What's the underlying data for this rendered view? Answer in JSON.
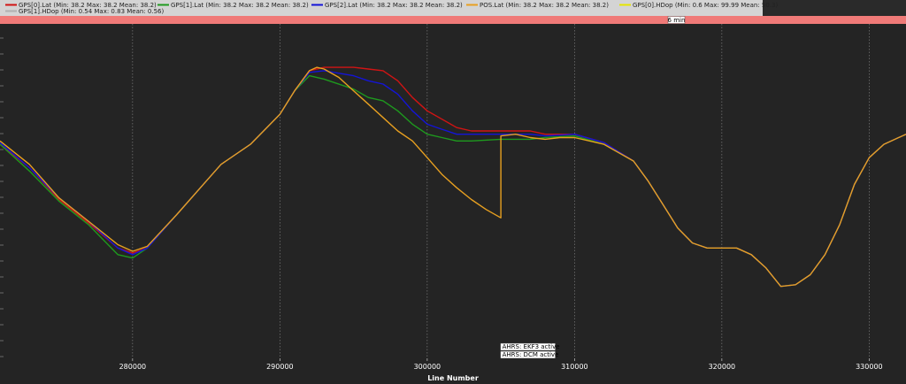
{
  "chart_data": {
    "type": "line",
    "xlabel": "Line Number",
    "ylabel": "",
    "xlim": [
      271000,
      332500
    ],
    "ylim": [
      0,
      1
    ],
    "x_ticks": [
      "280000",
      "290000",
      "300000",
      "310000",
      "320000",
      "330000"
    ],
    "x_tick_values": [
      280000,
      290000,
      300000,
      310000,
      320000,
      330000
    ],
    "grid": true,
    "legend_position": "top",
    "colors": {
      "background": "#242424",
      "grid": "#8a8a8a",
      "axis_band": "#d6d6d6",
      "legend_bg": "#d4d4d4",
      "time_band": "#f07a78"
    },
    "legend": [
      {
        "label": "GPS[0].Lat  (Min: 38.2 Max: 38.2 Mean: 38.2)",
        "color": "#d11414"
      },
      {
        "label": "GPS[1].Lat  (Min: 38.2 Max: 38.2 Mean: 38.2)",
        "color": "#1e9a1e"
      },
      {
        "label": "GPS[2].Lat  (Min: 38.2 Max: 38.2 Mean: 38.2)",
        "color": "#1414d8"
      },
      {
        "label": "POS.Lat  (Min: 38.2 Max: 38.2 Mean: 38.2)",
        "color": "#e8a020"
      },
      {
        "label": "GPS[0].HDop  (Min: 0.6 Max: 99.99 Mean: 50.3)",
        "color": "#e6e600"
      },
      {
        "label": "GPS[1].HDop  (Min: 0.54 Max: 0.83 Mean: 0.56)",
        "color": "#b0b0b0"
      }
    ],
    "time_marker": "6 min",
    "annotations": [
      "AHRS: EKF3 active",
      "AHRS: DCM active"
    ],
    "annotation_x": 305000,
    "series": [
      {
        "name": "GPS[0].Lat",
        "color": "#d11414",
        "x": [
          271000,
          273000,
          275000,
          277000,
          279000,
          280000,
          281000,
          283000,
          285000,
          286000,
          288000,
          290000,
          291000,
          292000,
          293000,
          295000,
          296000,
          297000,
          298000,
          299000,
          300000,
          301000,
          302000,
          303000,
          305000,
          307000,
          308000,
          310000,
          312000,
          314000,
          315000,
          316000,
          317000,
          318000,
          319000,
          320000,
          321000,
          322000,
          323000,
          324000,
          325000,
          326000,
          327000,
          328000,
          329000,
          330000,
          331000,
          332500
        ],
        "y": [
          0.64,
          0.57,
          0.475,
          0.405,
          0.33,
          0.315,
          0.33,
          0.43,
          0.53,
          0.58,
          0.64,
          0.73,
          0.8,
          0.86,
          0.87,
          0.87,
          0.865,
          0.86,
          0.83,
          0.78,
          0.74,
          0.715,
          0.69,
          0.68,
          0.68,
          0.68,
          0.67,
          0.67,
          0.645,
          0.59,
          0.53,
          0.46,
          0.39,
          0.345,
          0.33,
          0.33,
          0.33,
          0.31,
          0.27,
          0.215,
          0.22,
          0.25,
          0.31,
          0.4,
          0.52,
          0.6,
          0.64,
          0.67
        ]
      },
      {
        "name": "GPS[1].Lat",
        "color": "#1e9a1e",
        "x": [
          271000,
          273000,
          275000,
          277000,
          279000,
          280000,
          281000,
          283000,
          285000,
          286000,
          288000,
          290000,
          291000,
          292000,
          293000,
          295000,
          296000,
          297000,
          298000,
          299000,
          300000,
          301000,
          302000,
          303000,
          305000,
          307000,
          308000,
          310000,
          312000,
          314000,
          315000,
          316000,
          317000,
          318000,
          319000,
          320000,
          321000,
          322000,
          323000,
          324000,
          325000,
          326000,
          327000,
          328000,
          329000,
          330000,
          331000,
          332500
        ],
        "y": [
          0.64,
          0.56,
          0.47,
          0.4,
          0.31,
          0.3,
          0.33,
          0.43,
          0.53,
          0.58,
          0.64,
          0.73,
          0.8,
          0.845,
          0.835,
          0.805,
          0.78,
          0.77,
          0.74,
          0.7,
          0.67,
          0.66,
          0.65,
          0.65,
          0.655,
          0.655,
          0.66,
          0.665,
          0.64,
          0.59,
          0.53,
          0.46,
          0.39,
          0.345,
          0.33,
          0.33,
          0.33,
          0.31,
          0.27,
          0.215,
          0.22,
          0.25,
          0.31,
          0.4,
          0.52,
          0.6,
          0.64,
          0.67
        ]
      },
      {
        "name": "GPS[2].Lat",
        "color": "#1414d8",
        "x": [
          271000,
          273000,
          275000,
          277000,
          279000,
          280000,
          281000,
          283000,
          285000,
          286000,
          288000,
          290000,
          291000,
          292000,
          293000,
          295000,
          296000,
          297000,
          298000,
          299000,
          300000,
          301000,
          302000,
          303000,
          305000,
          307000,
          308000,
          310000,
          312000,
          314000,
          315000,
          316000,
          317000,
          318000,
          319000,
          320000,
          321000,
          322000,
          323000,
          324000,
          325000,
          326000,
          327000,
          328000,
          329000,
          330000,
          331000,
          332500
        ],
        "y": [
          0.645,
          0.57,
          0.48,
          0.41,
          0.33,
          0.31,
          0.33,
          0.43,
          0.53,
          0.58,
          0.64,
          0.73,
          0.8,
          0.855,
          0.86,
          0.845,
          0.83,
          0.82,
          0.79,
          0.74,
          0.7,
          0.685,
          0.67,
          0.67,
          0.67,
          0.67,
          0.665,
          0.67,
          0.645,
          0.59,
          0.53,
          0.46,
          0.39,
          0.345,
          0.33,
          0.33,
          0.33,
          0.31,
          0.27,
          0.215,
          0.22,
          0.25,
          0.31,
          0.4,
          0.52,
          0.6,
          0.64,
          0.67
        ]
      },
      {
        "name": "POS.Lat",
        "color": "#e8a020",
        "x": [
          271000,
          273000,
          275000,
          277000,
          279000,
          280000,
          281000,
          283000,
          285000,
          286000,
          288000,
          290000,
          291000,
          292000,
          292500,
          293000,
          294000,
          295000,
          296000,
          297000,
          298000,
          299000,
          300000,
          301000,
          302000,
          303000,
          304000,
          305000,
          305001,
          306000,
          307000,
          308000,
          309000,
          310000,
          312000,
          314000,
          315000,
          316000,
          317000,
          318000,
          319000,
          320000,
          321000,
          322000,
          323000,
          324000,
          325000,
          326000,
          327000,
          328000,
          329000,
          330000,
          331000,
          332500
        ],
        "y": [
          0.65,
          0.58,
          0.48,
          0.41,
          0.34,
          0.32,
          0.335,
          0.43,
          0.53,
          0.58,
          0.64,
          0.73,
          0.8,
          0.86,
          0.87,
          0.865,
          0.84,
          0.8,
          0.76,
          0.72,
          0.68,
          0.65,
          0.6,
          0.55,
          0.51,
          0.475,
          0.445,
          0.42,
          0.665,
          0.67,
          0.66,
          0.655,
          0.66,
          0.66,
          0.64,
          0.59,
          0.53,
          0.46,
          0.39,
          0.345,
          0.33,
          0.33,
          0.33,
          0.31,
          0.27,
          0.215,
          0.22,
          0.25,
          0.31,
          0.4,
          0.52,
          0.6,
          0.64,
          0.67
        ]
      }
    ]
  }
}
